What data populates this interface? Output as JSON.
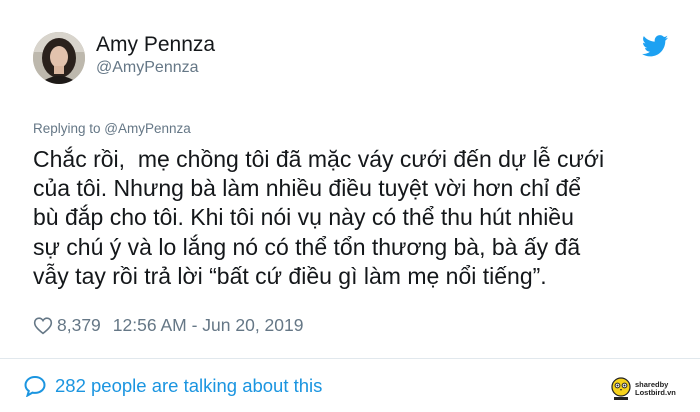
{
  "author": {
    "name": "Amy Pennza",
    "handle": "@AmyPennza"
  },
  "reply": {
    "label": "Replying to @AmyPennza"
  },
  "tweet": {
    "text": "Chắc rồi,  mẹ chồng tôi đã mặc váy cưới đến dự lễ cưới\ncủa tôi. Nhưng bà làm nhiều điều tuyệt vời hơn chỉ để\nbù đắp cho tôi. Khi tôi nói vụ này có thể thu hút nhiều\nsự chú ý và lo lắng nó có thể tổn thương bà, bà ấy đã\nvẫy tay rồi trả lời “bất cứ điều gì làm mẹ nổi tiếng”.",
    "likes": "8,379",
    "timestamp": "12:56 AM - Jun 20, 2019"
  },
  "footer": {
    "talking": "282 people are talking about this",
    "watermark_line1": "sharedby",
    "watermark_line2": "Lostbird.vn"
  },
  "icons": {
    "brand": "twitter-bird-icon",
    "like": "heart-icon",
    "talk": "speech-bubble-icon"
  },
  "colors": {
    "accent": "#1da1f2",
    "link": "#1b95e0",
    "muted": "#657786",
    "text": "#14171a"
  }
}
